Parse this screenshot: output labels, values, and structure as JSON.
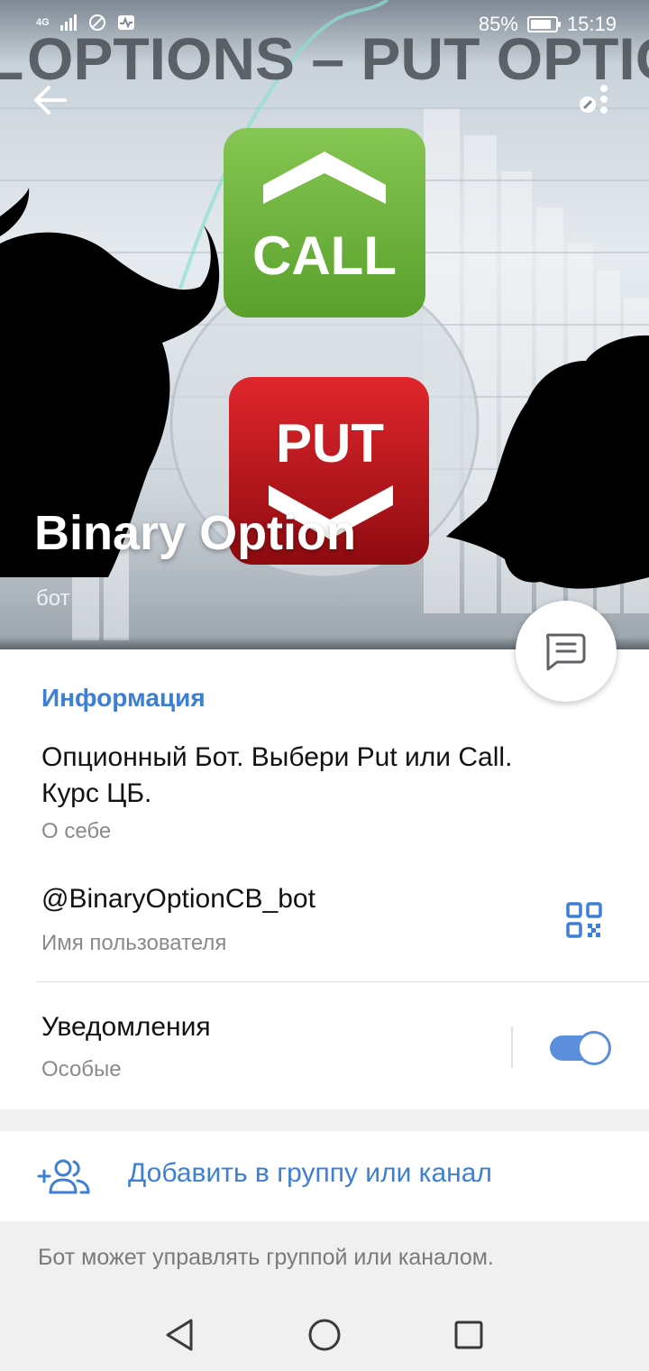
{
  "status_bar": {
    "network": "4G",
    "battery_percent": "85%",
    "battery_level": 0.85,
    "time": "15:19"
  },
  "header": {
    "banner_title": "OPTIONS – PUT OPTIO",
    "banner_left_fragment": "L",
    "call_label": "CALL",
    "put_label": "PUT",
    "call_color": "#6fb53e",
    "put_color": "#c2151c",
    "name": "Binary Option",
    "status": "бот"
  },
  "info": {
    "section_title": "Информация",
    "bio": "Опционный Бот. Выбери Put или Call. Курс ЦБ.",
    "bio_caption": "О себе",
    "username": "@BinaryOptionCB_bot",
    "username_caption": "Имя пользователя",
    "notifications_title": "Уведомления",
    "notifications_caption": "Особые",
    "notifications_enabled": true
  },
  "actions": {
    "add_to_group_label": "Добавить в группу или канал",
    "hint": "Бот может управлять группой или каналом."
  },
  "colors": {
    "accent": "#3d7fd6",
    "toggle": "#5b8fde"
  },
  "icons": {
    "back": "arrow-left-icon",
    "more": "more-vertical-icon",
    "message": "chat-bubble-icon",
    "qr": "qr-code-icon",
    "add_user": "add-users-icon",
    "nav_back": "triangle-back-icon",
    "nav_home": "circle-home-icon",
    "nav_recents": "square-recents-icon"
  }
}
